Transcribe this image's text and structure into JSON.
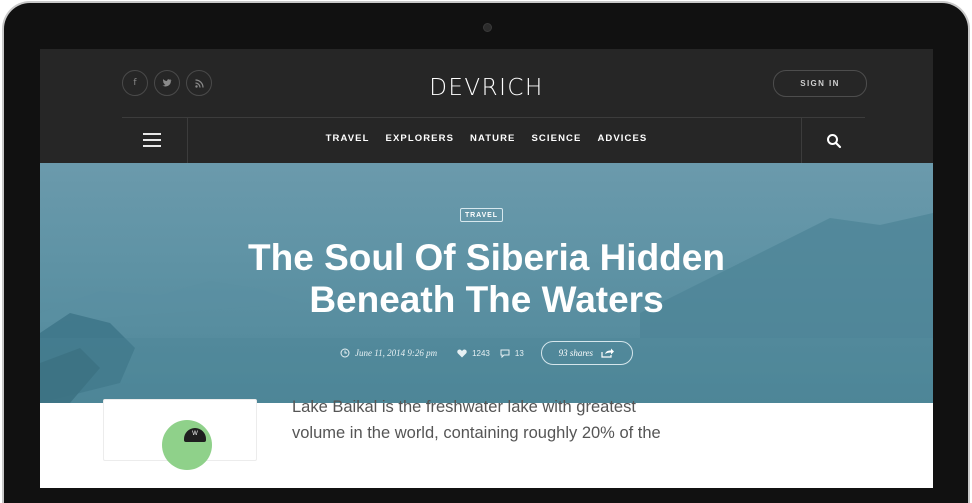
{
  "header": {
    "logo": "DEVRICH",
    "sign_in_label": "SIGN IN",
    "social": [
      {
        "icon": "facebook-icon",
        "glyph": "f"
      },
      {
        "icon": "twitter-icon",
        "glyph": "t"
      },
      {
        "icon": "rss-icon",
        "glyph": "r"
      }
    ],
    "menu": [
      "TRAVEL",
      "EXPLORERS",
      "NATURE",
      "SCIENCE",
      "ADVICES"
    ]
  },
  "hero": {
    "tag": "TRAVEL",
    "title_line1": "The Soul Of Siberia Hidden",
    "title_line2": "Beneath The Waters",
    "date": "June 11, 2014 9:26 pm",
    "likes": "1243",
    "comments": "13",
    "shares": "93 shares"
  },
  "article": {
    "line1": "Lake Baikal is the freshwater lake with greatest",
    "line2": "volume in the world, containing roughly 20% of the"
  },
  "colors": {
    "header_bg": "#262626",
    "hero_teal": "#5f93a5",
    "avatar_green": "#8fd18a"
  }
}
